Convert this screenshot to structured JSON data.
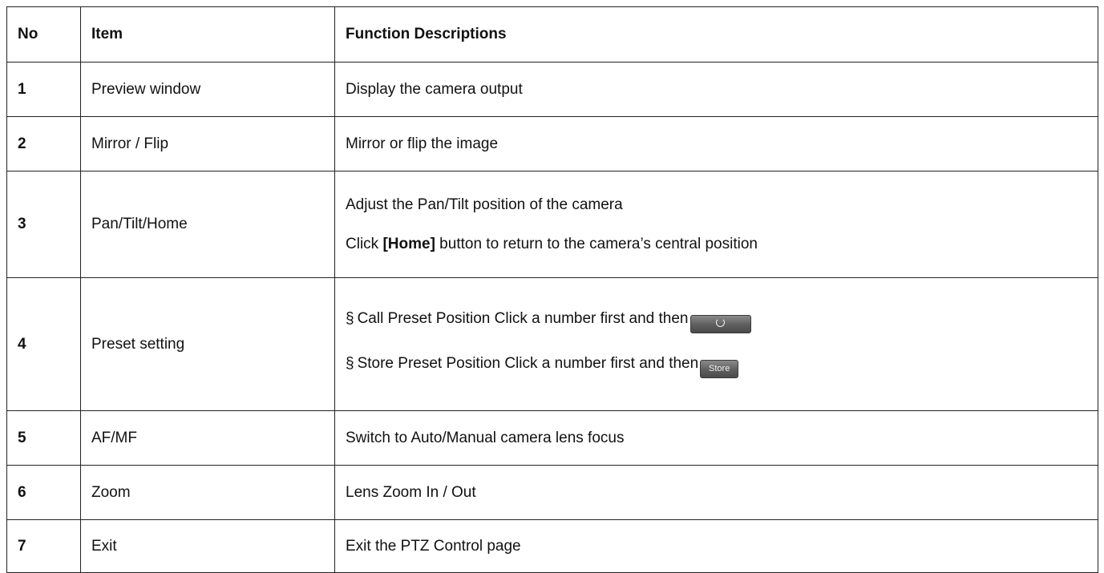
{
  "header": {
    "no": "No",
    "item": "Item",
    "desc": "Function Descriptions"
  },
  "rows": [
    {
      "no": "1",
      "item": "Preview window",
      "desc": "Display the camera output"
    },
    {
      "no": "2",
      "item": "Mirror / Flip",
      "desc": "Mirror or flip the image"
    },
    {
      "no": "3",
      "item": "Pan/Tilt/Home",
      "desc_line1": "Adjust the Pan/Tilt position of the camera",
      "desc_line2_pre": "Click ",
      "desc_line2_bold": "[Home]",
      "desc_line2_post": " button to return to the camera’s central position"
    },
    {
      "no": "4",
      "item": "Preset setting",
      "bullet": "§",
      "call_text": "Call Preset Position  Click a number first and then",
      "call_icon": "refresh-icon",
      "store_text": "Store Preset Position  Click a number first and then",
      "store_label": "Store"
    },
    {
      "no": "5",
      "item": "AF/MF",
      "desc": "Switch to Auto/Manual camera lens focus"
    },
    {
      "no": "6",
      "item": "Zoom",
      "desc": "Lens Zoom In / Out"
    },
    {
      "no": "7",
      "item": "Exit",
      "desc": "Exit the PTZ Control page"
    }
  ],
  "colors": {
    "border": "#222222",
    "button_bg": "#5e5e5e",
    "text": "#111111"
  }
}
